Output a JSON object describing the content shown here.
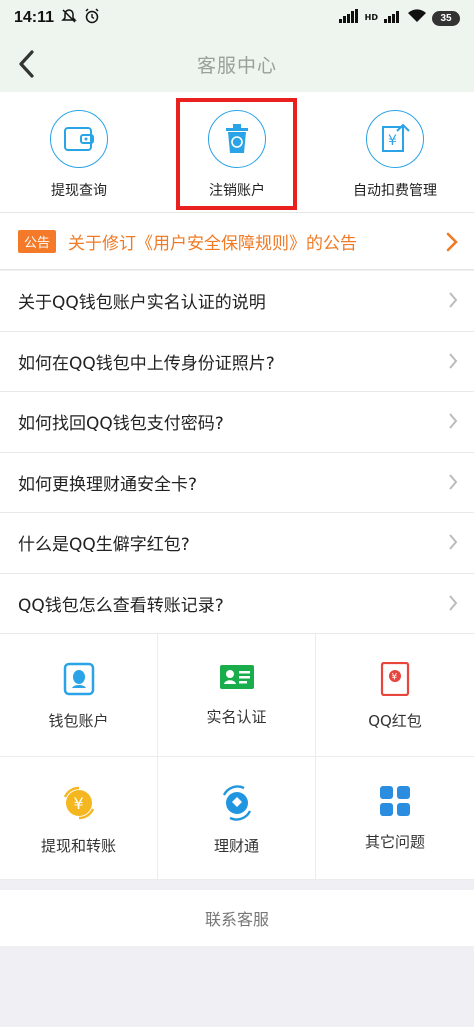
{
  "status_bar": {
    "time": "14:11",
    "battery": "35",
    "network": "HD"
  },
  "header": {
    "title": "客服中心"
  },
  "quick_actions": [
    {
      "label": "提现查询",
      "icon": "wallet-icon"
    },
    {
      "label": "注销账户",
      "icon": "recycle-bin-icon"
    },
    {
      "label": "自动扣费管理",
      "icon": "auto-debit-icon"
    }
  ],
  "notice": {
    "badge": "公告",
    "text": "关于修订《用户安全保障规则》的公告"
  },
  "faq": [
    {
      "text": "关于QQ钱包账户实名认证的说明"
    },
    {
      "text": "如何在QQ钱包中上传身份证照片?"
    },
    {
      "text": "如何找回QQ钱包支付密码?"
    },
    {
      "text": "如何更换理财通安全卡?"
    },
    {
      "text": "什么是QQ生僻字红包?"
    },
    {
      "text": "QQ钱包怎么查看转账记录?"
    }
  ],
  "categories": [
    {
      "label": "钱包账户",
      "icon": "wallet-account-icon"
    },
    {
      "label": "实名认证",
      "icon": "id-card-icon"
    },
    {
      "label": "QQ红包",
      "icon": "red-packet-icon"
    },
    {
      "label": "提现和转账",
      "icon": "transfer-icon"
    },
    {
      "label": "理财通",
      "icon": "wealth-icon"
    },
    {
      "label": "其它问题",
      "icon": "grid-icon"
    }
  ],
  "footer": {
    "contact_label": "联系客服"
  },
  "colors": {
    "accent": "#2ba3e7",
    "notice": "#f07a25",
    "highlight": "#e8211f"
  }
}
